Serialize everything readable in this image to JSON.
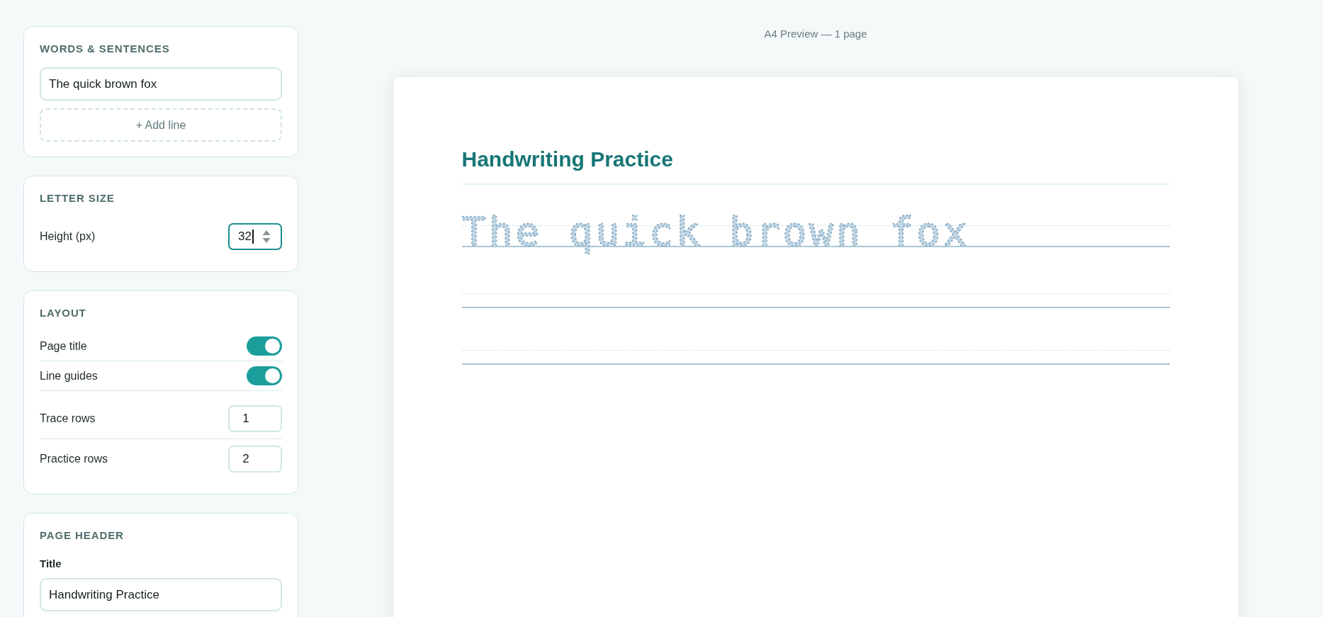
{
  "sidebar": {
    "words": {
      "heading": "WORDS & SENTENCES",
      "lines": [
        "The quick brown fox"
      ],
      "add_button": "+ Add line"
    },
    "letter_size": {
      "heading": "LETTER SIZE",
      "fields": [
        {
          "label": "Height (px)",
          "value": "32",
          "focused": true
        }
      ]
    },
    "layout": {
      "heading": "LAYOUT",
      "settings": [
        {
          "kind": "toggle",
          "label": "Page title",
          "on": true
        },
        {
          "kind": "toggle",
          "label": "Line guides",
          "on": true
        },
        {
          "kind": "number",
          "label": "Trace rows",
          "value": "1"
        },
        {
          "kind": "number",
          "label": "Practice rows",
          "value": "2"
        }
      ]
    },
    "page_header": {
      "heading": "PAGE HEADER",
      "fields": [
        {
          "label": "Title",
          "value": "Handwriting Practice"
        }
      ]
    }
  },
  "preview": {
    "caption": "A4 Preview — 1 page",
    "page": {
      "title": "Handwriting Practice",
      "rows": [
        {
          "kind": "trace",
          "text": "The quick brown fox"
        },
        {
          "kind": "practice"
        },
        {
          "kind": "practice"
        }
      ]
    }
  }
}
